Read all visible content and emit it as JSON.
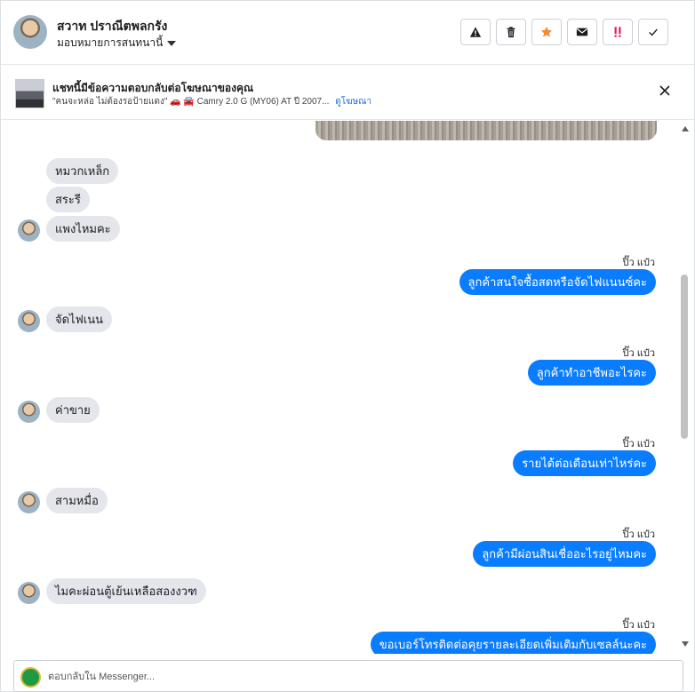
{
  "header": {
    "contact_name": "สวาท ปราณีตพลกรัง",
    "assign_label": "มอบหมายการสนทนานี้",
    "actions": [
      {
        "icon": "warning-icon",
        "color": "#1c1e21"
      },
      {
        "icon": "trash-icon",
        "color": "#1c1e21"
      },
      {
        "icon": "star-icon",
        "color": "#f28b30"
      },
      {
        "icon": "mail-icon",
        "color": "#1c1e21"
      },
      {
        "icon": "priority-icon",
        "color": "#e0245e"
      },
      {
        "icon": "check-icon",
        "color": "#1c1e21"
      }
    ]
  },
  "ad_banner": {
    "title": "แชทนี้มีข้อความตอบกลับต่อโฆษณาของคุณ",
    "subtitle": "\"คนจะหล่อ ไม่ต้องรอป้ายแดง\" 🚗 🚘 Camry 2.0 G (MY06) AT ปี 2007...",
    "link": "ดูโฆษณา"
  },
  "messages": {
    "m1": "หมวกเหล็ก",
    "m2": "สระรี",
    "m3": "แพงไหมคะ",
    "t1": "ปิ๊ว แป๋ว",
    "o1": "ลูกค้าสนใจซื้อสดหรือจัดไฟแนนซ์คะ",
    "m4": "จัดไฟเนน",
    "t2": "ปิ๊ว แป๋ว",
    "o2": "ลูกค้าทำอาชีพอะไรคะ",
    "m5": "ค่าขาย",
    "t3": "ปิ๊ว แป๋ว",
    "o3": "รายได้ต่อเดือนเท่าไหร่คะ",
    "m6": "สามหมื่อ",
    "t4": "ปิ๊ว แป๋ว",
    "o4": "ลูกค้ามีผ่อนสินเชื่ออะไรอยู่ไหมคะ",
    "m7": "ไมคะผ่อนตู้เย้นเหลือสองงวฑ",
    "t5": "ปิ๊ว แป๋ว",
    "o5": "ขอเบอร์โทรติดต่อคุยรายละเอียดเพิ่มเติมกับเซลล์นะคะ"
  },
  "composer": {
    "placeholder": "ตอบกลับใน Messenger..."
  },
  "colors": {
    "outgoing_bubble": "#0a7cff",
    "incoming_bubble": "#e4e6eb",
    "link": "#216fdb"
  }
}
